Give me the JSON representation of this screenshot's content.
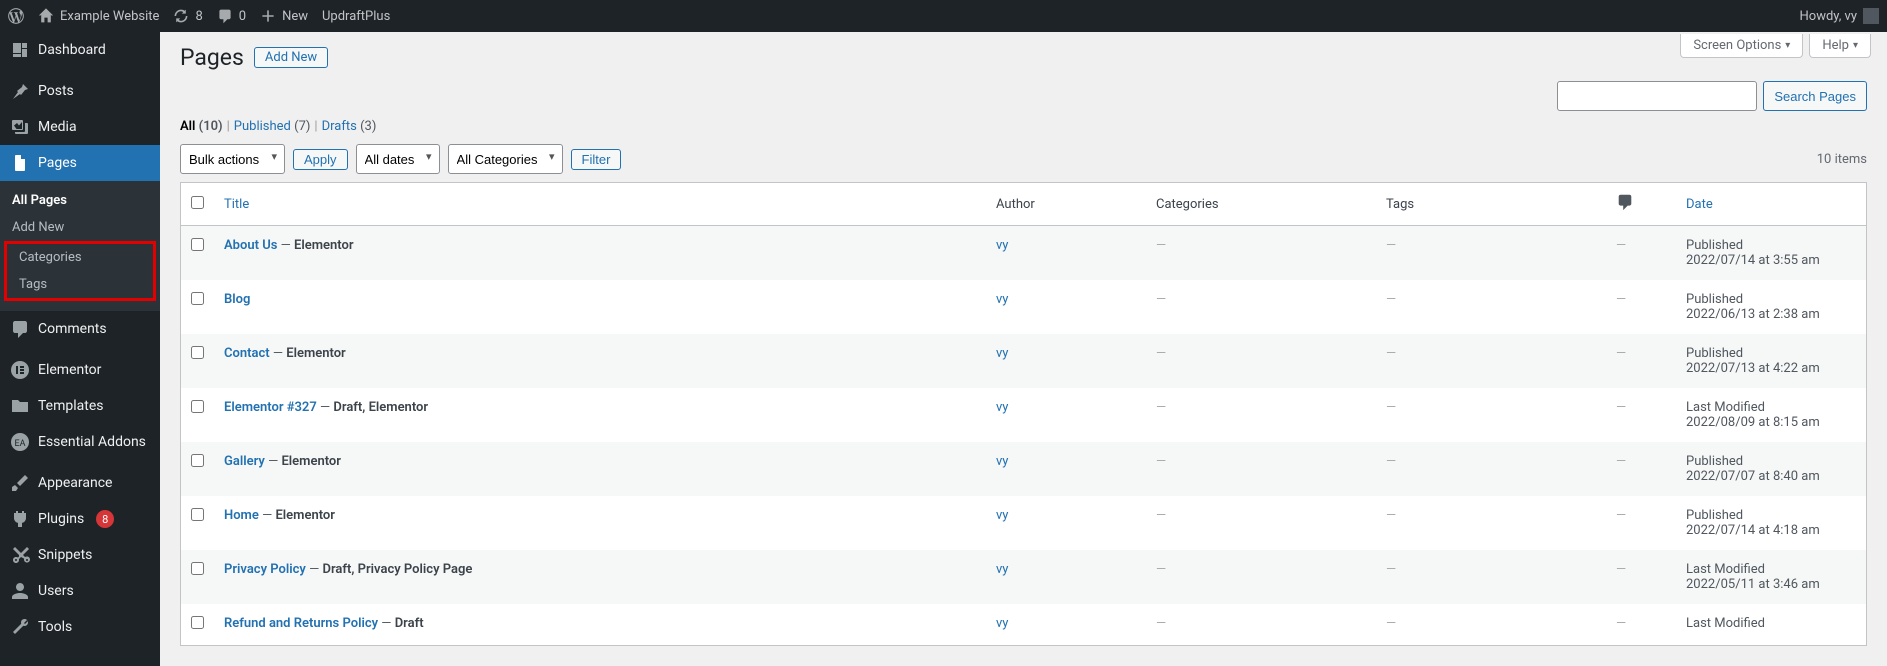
{
  "adminbar": {
    "site_name": "Example Website",
    "updates_count": "8",
    "comments_count": "0",
    "new_label": "New",
    "extra": "UpdraftPlus",
    "howdy": "Howdy, vy"
  },
  "screen_meta": {
    "options": "Screen Options",
    "help": "Help"
  },
  "sidebar": {
    "dashboard": "Dashboard",
    "posts": "Posts",
    "media": "Media",
    "pages": "Pages",
    "pages_sub": {
      "all": "All Pages",
      "add": "Add New",
      "categories": "Categories",
      "tags": "Tags"
    },
    "comments": "Comments",
    "elementor": "Elementor",
    "templates": "Templates",
    "essential": "Essential Addons",
    "appearance": "Appearance",
    "plugins": "Plugins",
    "plugins_badge": "8",
    "snippets": "Snippets",
    "users": "Users",
    "tools": "Tools"
  },
  "heading": {
    "title": "Pages",
    "add_new": "Add New"
  },
  "views": {
    "all_label": "All",
    "all_count": "(10)",
    "pub_label": "Published",
    "pub_count": "(7)",
    "draft_label": "Drafts",
    "draft_count": "(3)"
  },
  "filters": {
    "bulk": "Bulk actions",
    "apply": "Apply",
    "dates": "All dates",
    "cats": "All Categories",
    "filter": "Filter",
    "search": "Search Pages",
    "items": "10 items"
  },
  "columns": {
    "title": "Title",
    "author": "Author",
    "cats": "Categories",
    "tags": "Tags",
    "date": "Date"
  },
  "rows": [
    {
      "title": "About Us",
      "state": "Elementor",
      "author": "vy",
      "cat": "—",
      "tag": "—",
      "comm": "—",
      "date_label": "Published",
      "date": "2022/07/14 at 3:55 am"
    },
    {
      "title": "Blog",
      "state": "",
      "author": "vy",
      "cat": "—",
      "tag": "—",
      "comm": "—",
      "date_label": "Published",
      "date": "2022/06/13 at 2:38 am"
    },
    {
      "title": "Contact",
      "state": "Elementor",
      "author": "vy",
      "cat": "—",
      "tag": "—",
      "comm": "—",
      "date_label": "Published",
      "date": "2022/07/13 at 4:22 am"
    },
    {
      "title": "Elementor #327",
      "state": "Draft, Elementor",
      "author": "vy",
      "cat": "—",
      "tag": "—",
      "comm": "—",
      "date_label": "Last Modified",
      "date": "2022/08/09 at 8:15 am"
    },
    {
      "title": "Gallery",
      "state": "Elementor",
      "author": "vy",
      "cat": "—",
      "tag": "—",
      "comm": "—",
      "date_label": "Published",
      "date": "2022/07/07 at 8:40 am"
    },
    {
      "title": "Home",
      "state": "Elementor",
      "author": "vy",
      "cat": "—",
      "tag": "—",
      "comm": "—",
      "date_label": "Published",
      "date": "2022/07/14 at 4:18 am"
    },
    {
      "title": "Privacy Policy",
      "state": "Draft, Privacy Policy Page",
      "author": "vy",
      "cat": "—",
      "tag": "—",
      "comm": "—",
      "date_label": "Last Modified",
      "date": "2022/05/11 at 3:46 am"
    },
    {
      "title": "Refund and Returns Policy",
      "state": "Draft",
      "author": "vy",
      "cat": "—",
      "tag": "—",
      "comm": "—",
      "date_label": "Last Modified",
      "date": ""
    }
  ]
}
